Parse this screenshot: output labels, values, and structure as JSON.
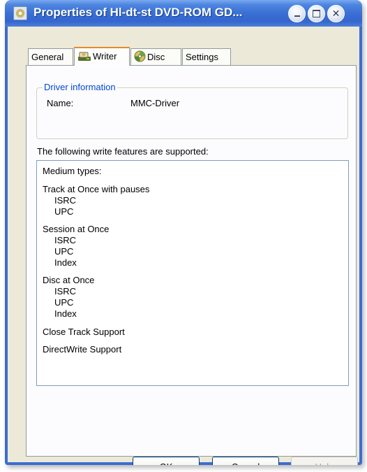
{
  "window": {
    "title": "Properties of Hl-dt-st DVD-ROM GD...",
    "app_icon": "cd-drive-icon"
  },
  "tabs": [
    {
      "label": "General",
      "icon": null
    },
    {
      "label": "Writer",
      "icon": "writer-icon"
    },
    {
      "label": "Disc",
      "icon": "disc-icon"
    },
    {
      "label": "Settings",
      "icon": null
    }
  ],
  "active_tab": "Writer",
  "driver_info": {
    "group_label": "Driver information",
    "name_label": "Name:",
    "name_value": "MMC-Driver"
  },
  "features": {
    "label": "The following write features are supported:",
    "items": [
      {
        "text": "Medium types:",
        "indent": 0
      },
      {
        "text": "Track at Once with pauses",
        "indent": 0
      },
      {
        "text": "ISRC",
        "indent": 1
      },
      {
        "text": "UPC",
        "indent": 1
      },
      {
        "text": "Session at Once",
        "indent": 0
      },
      {
        "text": "ISRC",
        "indent": 1
      },
      {
        "text": "UPC",
        "indent": 1
      },
      {
        "text": "Index",
        "indent": 1
      },
      {
        "text": "Disc at Once",
        "indent": 0
      },
      {
        "text": "ISRC",
        "indent": 1
      },
      {
        "text": "UPC",
        "indent": 1
      },
      {
        "text": "Index",
        "indent": 1
      },
      {
        "text": "Close Track Support",
        "indent": 0
      },
      {
        "text": "DirectWrite Support",
        "indent": 0
      }
    ]
  },
  "buttons": {
    "ok": "OK",
    "cancel": "Cancel",
    "help": "Help"
  },
  "colors": {
    "titlebar": "#3a6fd4",
    "dialog_face": "#ece9d8",
    "active_tab_highlight": "#e68b2c",
    "groupbox_label": "#0046d5"
  }
}
